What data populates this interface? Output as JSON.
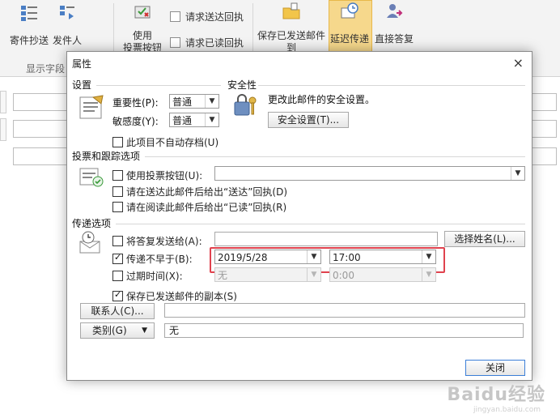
{
  "ribbon": {
    "buttons": {
      "by_sender": "寄件抄送",
      "sender": "发件人",
      "use_vote_buttons": "使用\n投票按钮",
      "request_delivery": "请求送达回执",
      "request_read": "请求已读回执",
      "save_sent": "保存已发送邮件\n到",
      "delay_delivery": "延迟传递",
      "direct_reply": "直接答复"
    },
    "group_label": "显示字段"
  },
  "dialog": {
    "title": "属性",
    "close_glyph": "×",
    "settings": {
      "section": "设置",
      "importance_label": "重要性(P):",
      "importance_value": "普通",
      "sensitivity_label": "敏感度(Y):",
      "sensitivity_value": "普通",
      "no_autoarchive": "此项目不自动存档(U)"
    },
    "security": {
      "section": "安全性",
      "desc": "更改此邮件的安全设置。",
      "button": "安全设置(T)..."
    },
    "voting": {
      "section": "投票和跟踪选项",
      "use_vote": "使用投票按钮(U):",
      "delivery_receipt": "请在送达此邮件后给出“送达”回执(D)",
      "read_receipt": "请在阅读此邮件后给出“已读”回执(R)"
    },
    "delivery": {
      "section": "传递选项",
      "reply_to": "将答复发送给(A):",
      "select_names": "选择姓名(L)...",
      "not_before": "传递不早于(B):",
      "not_before_date": "2019/5/28",
      "not_before_time": "17:00",
      "expires": "过期时间(X):",
      "expires_date": "无",
      "expires_time": "0:00",
      "save_copy": "保存已发送邮件的副本(S)"
    },
    "contacts_button": "联系人(C)...",
    "categories_button": "类别(G)",
    "categories_value": "无",
    "close_button": "关闭"
  },
  "watermark": "Baidu经验",
  "watermark_sub": "jingyan.baidu.com"
}
